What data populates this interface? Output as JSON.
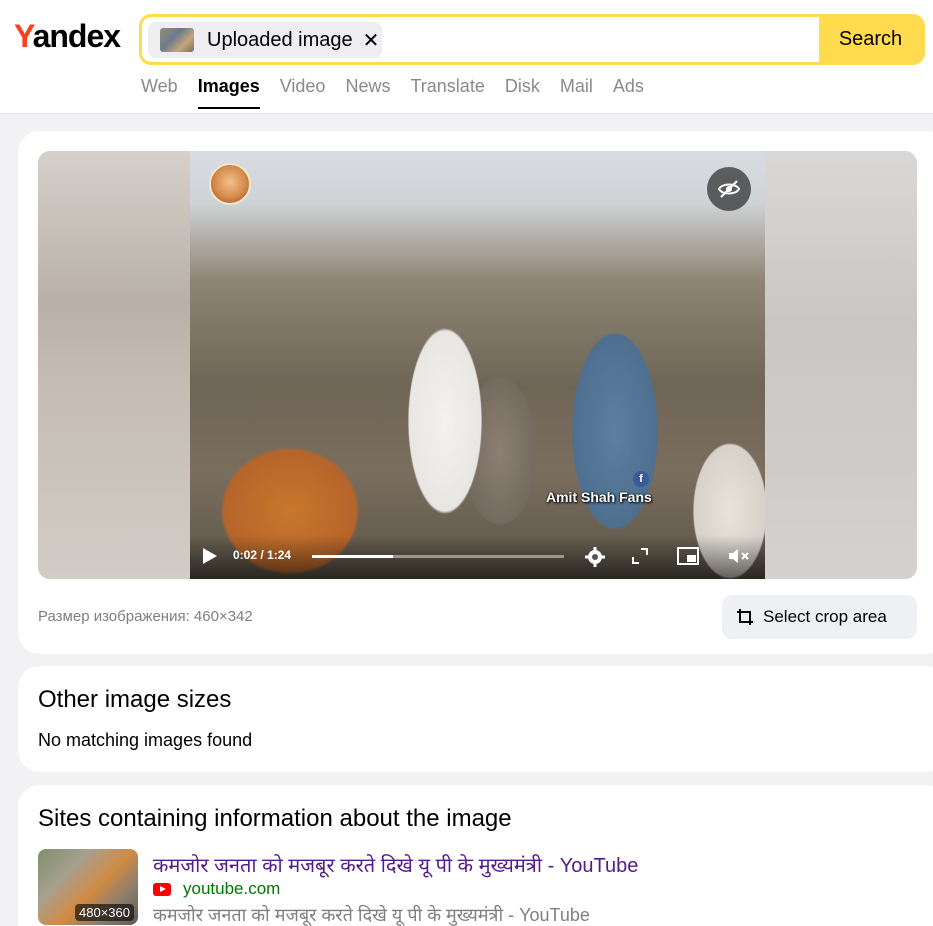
{
  "header": {
    "logo_first": "Y",
    "logo_rest": "andex",
    "search_chip_label": "Uploaded image",
    "search_chip_remove": "✕",
    "search_button": "Search",
    "tabs": [
      {
        "label": "Web",
        "active": false
      },
      {
        "label": "Images",
        "active": true
      },
      {
        "label": "Video",
        "active": false
      },
      {
        "label": "News",
        "active": false
      },
      {
        "label": "Translate",
        "active": false
      },
      {
        "label": "Disk",
        "active": false
      },
      {
        "label": "Mail",
        "active": false
      },
      {
        "label": "Ads",
        "active": false
      }
    ]
  },
  "preview": {
    "video_watermark": "Amit Shah Fans",
    "fb_badge": "f",
    "time": "0:02 / 1:24",
    "progress_fraction": 0.32,
    "controls": [
      "settings-icon",
      "fullscreen-icon",
      "pip-icon",
      "mute-icon"
    ],
    "image_size_text": "Размер изображения: 460×342",
    "crop_button": "Select crop area"
  },
  "other_sizes": {
    "title": "Other image sizes",
    "message": "No matching images found"
  },
  "sites": {
    "title": "Sites containing information about the image",
    "items": [
      {
        "thumb_resolution": "480×360",
        "title": "कमजोर जनता को मजबूर करते दिखे यू पी के मुख्यमंत्री - YouTube",
        "domain": "youtube.com",
        "description": "कमजोर जनता को मजबूर करते दिखे यू पी के मुख्यमंत्री - YouTube"
      }
    ]
  },
  "colors": {
    "accent_yellow": "#ffdb4d",
    "logo_red": "#fc3f1d",
    "link_purple": "#551a8b",
    "domain_green": "#007700"
  }
}
